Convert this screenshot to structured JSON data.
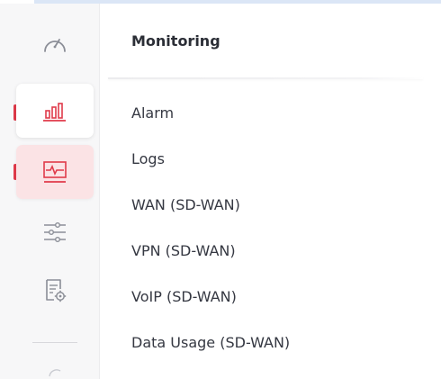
{
  "panel": {
    "title": "Monitoring",
    "items": [
      {
        "label": "Alarm"
      },
      {
        "label": "Logs"
      },
      {
        "label": "WAN (SD-WAN)"
      },
      {
        "label": "VPN (SD-WAN)"
      },
      {
        "label": "VoIP (SD-WAN)"
      },
      {
        "label": "Data Usage (SD-WAN)"
      }
    ]
  },
  "rail": {
    "icons": [
      "dashboard-gauge-icon",
      "bar-chart-icon",
      "monitor-pulse-icon",
      "sliders-icon",
      "document-gear-icon",
      "truncated-icon"
    ]
  },
  "colors": {
    "accent": "#e03a4a",
    "active_bg": "#fbe3e5",
    "icon_gray": "#8b8e97",
    "text": "#353842"
  }
}
